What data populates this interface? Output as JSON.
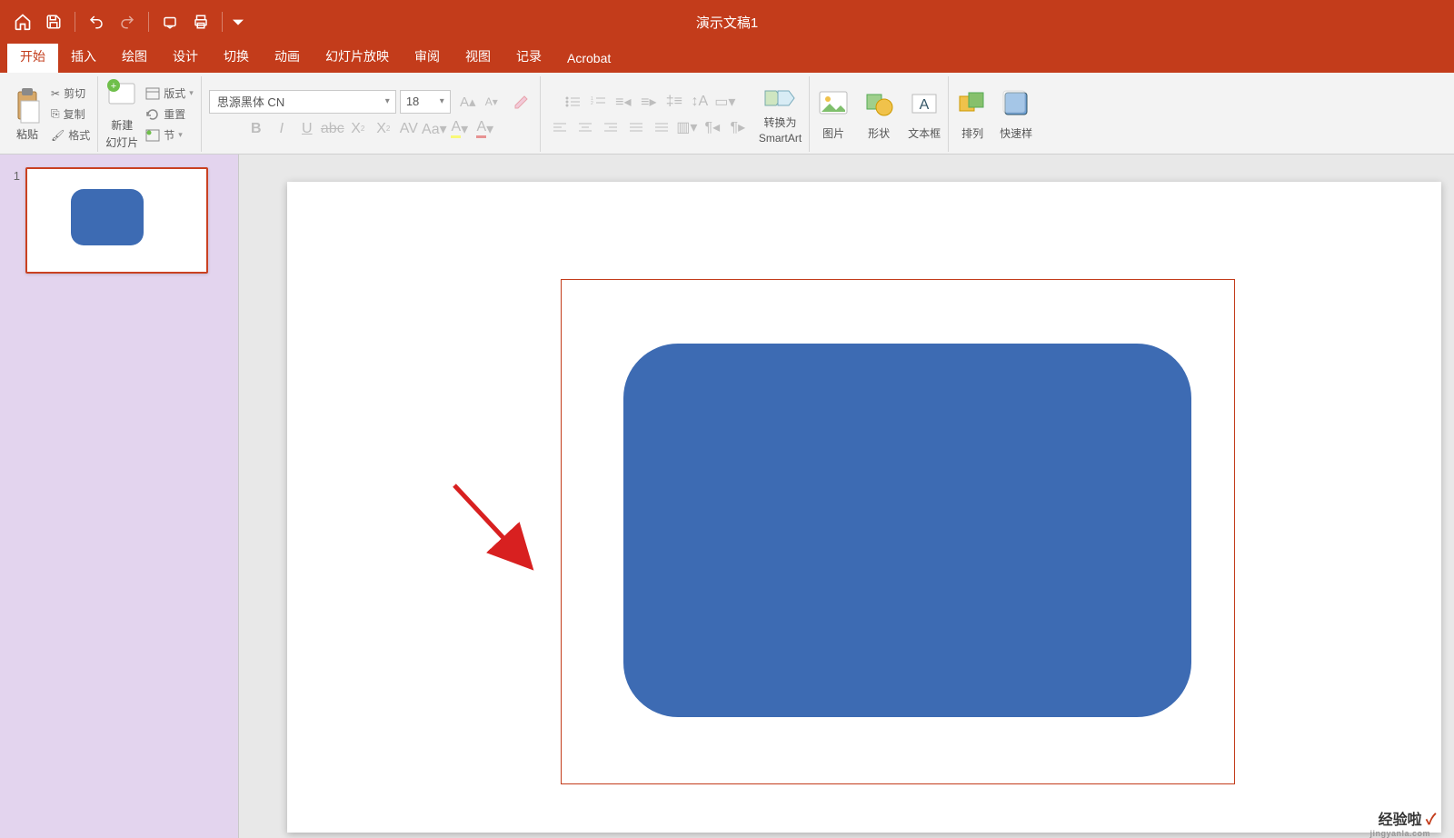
{
  "title": "演示文稿1",
  "tabs": {
    "home": "开始",
    "insert": "插入",
    "draw": "绘图",
    "design": "设计",
    "transition": "切换",
    "animation": "动画",
    "slideshow": "幻灯片放映",
    "review": "审阅",
    "view": "视图",
    "record": "记录",
    "acrobat": "Acrobat"
  },
  "ribbon": {
    "paste": "粘贴",
    "cut": "剪切",
    "copy": "复制",
    "format": "格式",
    "newslide_l1": "新建",
    "newslide_l2": "幻灯片",
    "layout": "版式",
    "reset": "重置",
    "section": "节",
    "font_name": "思源黑体 CN",
    "font_size": "18",
    "convert_l1": "转换为",
    "convert_l2": "SmartArt",
    "picture": "图片",
    "shape": "形状",
    "textbox": "文本框",
    "arrange": "排列",
    "quickstyle": "快速样"
  },
  "slide_number": "1",
  "watermark": {
    "main": "经验啦",
    "check": "✓",
    "sub": "jingyanla.com"
  }
}
